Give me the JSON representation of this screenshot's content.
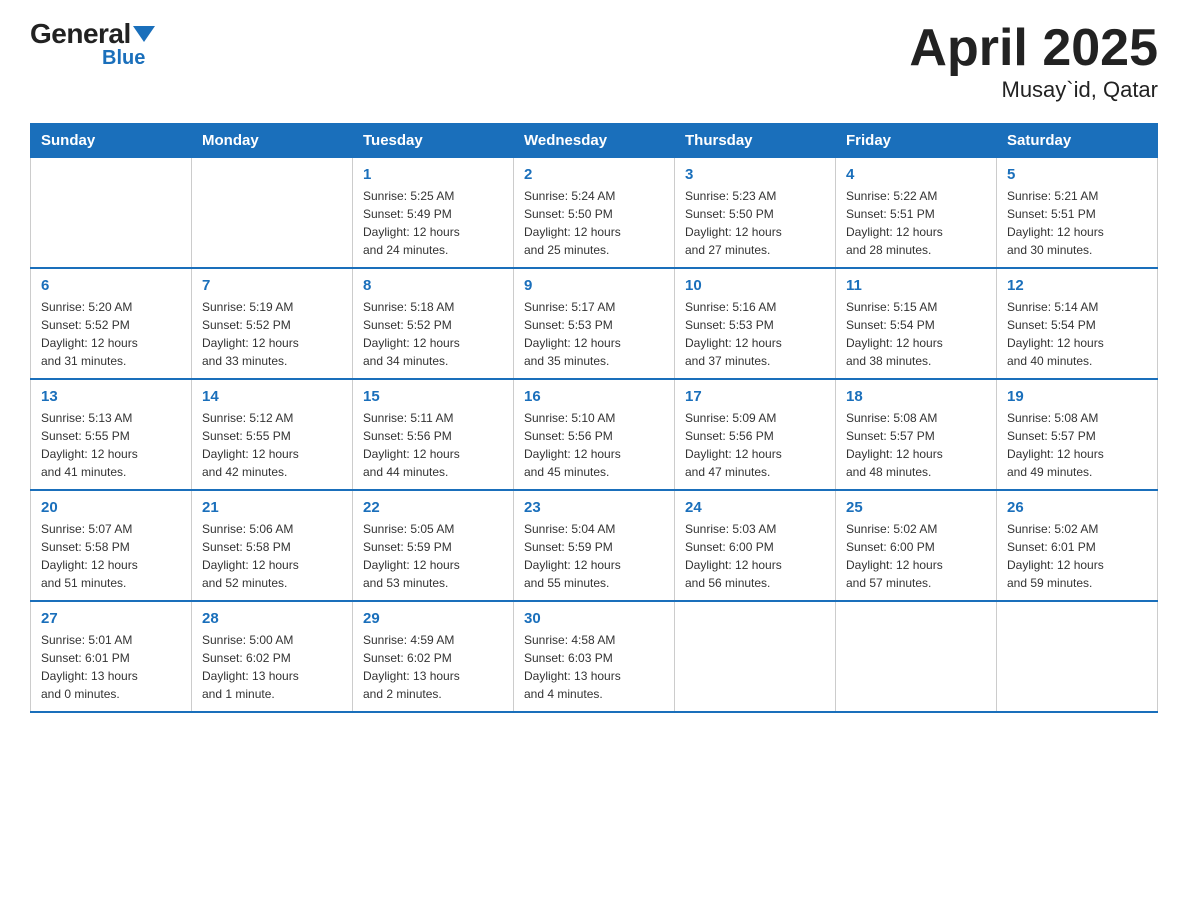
{
  "logo": {
    "general": "General",
    "blue": "Blue"
  },
  "title": "April 2025",
  "subtitle": "Musay`id, Qatar",
  "headers": [
    "Sunday",
    "Monday",
    "Tuesday",
    "Wednesday",
    "Thursday",
    "Friday",
    "Saturday"
  ],
  "weeks": [
    [
      {
        "day": "",
        "info": ""
      },
      {
        "day": "",
        "info": ""
      },
      {
        "day": "1",
        "info": "Sunrise: 5:25 AM\nSunset: 5:49 PM\nDaylight: 12 hours\nand 24 minutes."
      },
      {
        "day": "2",
        "info": "Sunrise: 5:24 AM\nSunset: 5:50 PM\nDaylight: 12 hours\nand 25 minutes."
      },
      {
        "day": "3",
        "info": "Sunrise: 5:23 AM\nSunset: 5:50 PM\nDaylight: 12 hours\nand 27 minutes."
      },
      {
        "day": "4",
        "info": "Sunrise: 5:22 AM\nSunset: 5:51 PM\nDaylight: 12 hours\nand 28 minutes."
      },
      {
        "day": "5",
        "info": "Sunrise: 5:21 AM\nSunset: 5:51 PM\nDaylight: 12 hours\nand 30 minutes."
      }
    ],
    [
      {
        "day": "6",
        "info": "Sunrise: 5:20 AM\nSunset: 5:52 PM\nDaylight: 12 hours\nand 31 minutes."
      },
      {
        "day": "7",
        "info": "Sunrise: 5:19 AM\nSunset: 5:52 PM\nDaylight: 12 hours\nand 33 minutes."
      },
      {
        "day": "8",
        "info": "Sunrise: 5:18 AM\nSunset: 5:52 PM\nDaylight: 12 hours\nand 34 minutes."
      },
      {
        "day": "9",
        "info": "Sunrise: 5:17 AM\nSunset: 5:53 PM\nDaylight: 12 hours\nand 35 minutes."
      },
      {
        "day": "10",
        "info": "Sunrise: 5:16 AM\nSunset: 5:53 PM\nDaylight: 12 hours\nand 37 minutes."
      },
      {
        "day": "11",
        "info": "Sunrise: 5:15 AM\nSunset: 5:54 PM\nDaylight: 12 hours\nand 38 minutes."
      },
      {
        "day": "12",
        "info": "Sunrise: 5:14 AM\nSunset: 5:54 PM\nDaylight: 12 hours\nand 40 minutes."
      }
    ],
    [
      {
        "day": "13",
        "info": "Sunrise: 5:13 AM\nSunset: 5:55 PM\nDaylight: 12 hours\nand 41 minutes."
      },
      {
        "day": "14",
        "info": "Sunrise: 5:12 AM\nSunset: 5:55 PM\nDaylight: 12 hours\nand 42 minutes."
      },
      {
        "day": "15",
        "info": "Sunrise: 5:11 AM\nSunset: 5:56 PM\nDaylight: 12 hours\nand 44 minutes."
      },
      {
        "day": "16",
        "info": "Sunrise: 5:10 AM\nSunset: 5:56 PM\nDaylight: 12 hours\nand 45 minutes."
      },
      {
        "day": "17",
        "info": "Sunrise: 5:09 AM\nSunset: 5:56 PM\nDaylight: 12 hours\nand 47 minutes."
      },
      {
        "day": "18",
        "info": "Sunrise: 5:08 AM\nSunset: 5:57 PM\nDaylight: 12 hours\nand 48 minutes."
      },
      {
        "day": "19",
        "info": "Sunrise: 5:08 AM\nSunset: 5:57 PM\nDaylight: 12 hours\nand 49 minutes."
      }
    ],
    [
      {
        "day": "20",
        "info": "Sunrise: 5:07 AM\nSunset: 5:58 PM\nDaylight: 12 hours\nand 51 minutes."
      },
      {
        "day": "21",
        "info": "Sunrise: 5:06 AM\nSunset: 5:58 PM\nDaylight: 12 hours\nand 52 minutes."
      },
      {
        "day": "22",
        "info": "Sunrise: 5:05 AM\nSunset: 5:59 PM\nDaylight: 12 hours\nand 53 minutes."
      },
      {
        "day": "23",
        "info": "Sunrise: 5:04 AM\nSunset: 5:59 PM\nDaylight: 12 hours\nand 55 minutes."
      },
      {
        "day": "24",
        "info": "Sunrise: 5:03 AM\nSunset: 6:00 PM\nDaylight: 12 hours\nand 56 minutes."
      },
      {
        "day": "25",
        "info": "Sunrise: 5:02 AM\nSunset: 6:00 PM\nDaylight: 12 hours\nand 57 minutes."
      },
      {
        "day": "26",
        "info": "Sunrise: 5:02 AM\nSunset: 6:01 PM\nDaylight: 12 hours\nand 59 minutes."
      }
    ],
    [
      {
        "day": "27",
        "info": "Sunrise: 5:01 AM\nSunset: 6:01 PM\nDaylight: 13 hours\nand 0 minutes."
      },
      {
        "day": "28",
        "info": "Sunrise: 5:00 AM\nSunset: 6:02 PM\nDaylight: 13 hours\nand 1 minute."
      },
      {
        "day": "29",
        "info": "Sunrise: 4:59 AM\nSunset: 6:02 PM\nDaylight: 13 hours\nand 2 minutes."
      },
      {
        "day": "30",
        "info": "Sunrise: 4:58 AM\nSunset: 6:03 PM\nDaylight: 13 hours\nand 4 minutes."
      },
      {
        "day": "",
        "info": ""
      },
      {
        "day": "",
        "info": ""
      },
      {
        "day": "",
        "info": ""
      }
    ]
  ]
}
